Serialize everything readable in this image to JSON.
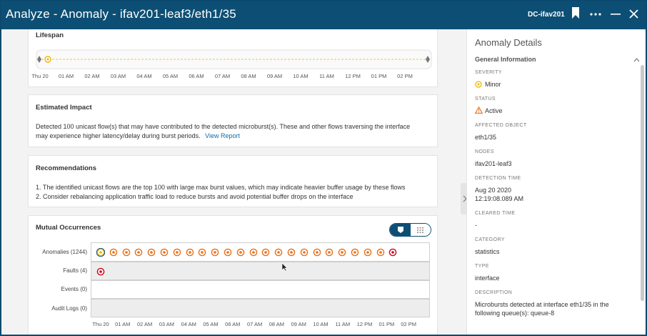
{
  "window": {
    "title": "Analyze - Anomaly - ifav201-leaf3/eth1/35",
    "fabric": "DC-ifav201",
    "bookmark_icon": "bookmark-icon",
    "more_icon": "more-icon",
    "minimize_icon": "minimize-icon",
    "close_icon": "close-icon",
    "colors": {
      "titlebar": "#0d4f74",
      "link": "#0d6eaa",
      "minor": "#f0b400",
      "warning": "#e8701a",
      "critical": "#d0021b"
    }
  },
  "lifespan": {
    "title": "Lifespan",
    "ticks": [
      "Thu 20",
      "01 AM",
      "02 AM",
      "03 AM",
      "04 AM",
      "05 AM",
      "06 AM",
      "07 AM",
      "08 AM",
      "09 AM",
      "10 AM",
      "11 AM",
      "12 PM",
      "01 PM",
      "02 PM"
    ]
  },
  "impact": {
    "title": "Estimated Impact",
    "line1": "Detected 100 unicast flow(s) that may have contributed to the detected microburst(s). These and other flows traversing the interface",
    "line2": "may experience higher latency/delay during burst periods.",
    "link": "View Report"
  },
  "recommendations": {
    "title": "Recommendations",
    "items": [
      "1. The identified unicast flows are the top 100 with large max burst values, which may indicate heavier buffer usage by these flows",
      "2. Consider rebalancing application traffic load to reduce bursts and avoid potential buffer drops on the interface"
    ]
  },
  "mutual": {
    "title": "Mutual Occurrences",
    "toggle_icons": [
      "timeline-icon",
      "grid-icon"
    ],
    "rows": [
      {
        "label": "Anomalies (1244)"
      },
      {
        "label": "Faults (4)"
      },
      {
        "label": "Events (0)"
      },
      {
        "label": "Audit Logs (0)"
      }
    ],
    "anomaly_icons_count": 24,
    "fault_icons_count": 1,
    "ticks": [
      "Thu 20",
      "01 AM",
      "02 AM",
      "03 AM",
      "04 AM",
      "05 AM",
      "06 AM",
      "07 AM",
      "08 AM",
      "09 AM",
      "10 AM",
      "11 AM",
      "12 PM",
      "01 PM",
      "02 PM"
    ]
  },
  "details": {
    "heading": "Anomaly Details",
    "section": "General Information",
    "fields": [
      {
        "label": "SEVERITY",
        "value": "Minor"
      },
      {
        "label": "STATUS",
        "value": "Active"
      },
      {
        "label": "AFFECTED OBJECT",
        "value": "eth1/35"
      },
      {
        "label": "NODES",
        "value": "ifav201-leaf3"
      },
      {
        "label": "DETECTION TIME",
        "value": "Aug 20 2020",
        "value2": "12:19:08.089 AM"
      },
      {
        "label": "CLEARED TIME",
        "value": "-"
      },
      {
        "label": "CATEGORY",
        "value": "statistics"
      },
      {
        "label": "TYPE",
        "value": "interface"
      },
      {
        "label": "DESCRIPTION",
        "value": "Microbursts detected at interface eth1/35 in the",
        "value2": "following queue(s): queue-8"
      }
    ]
  }
}
